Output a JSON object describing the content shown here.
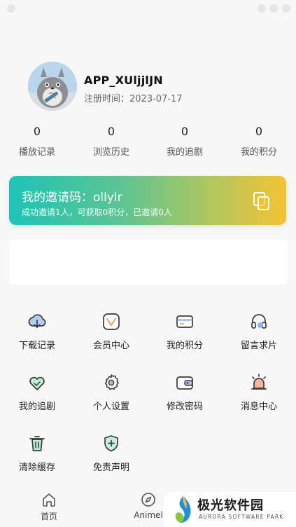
{
  "profile": {
    "username": "APP_XUljjlJN",
    "register_date": "注册时间：2023-07-17"
  },
  "stats": [
    {
      "value": "0",
      "label": "播放记录"
    },
    {
      "value": "0",
      "label": "浏览历史"
    },
    {
      "value": "0",
      "label": "我的追剧"
    },
    {
      "value": "0",
      "label": "我的积分"
    }
  ],
  "invite": {
    "code_text": "我的邀请码：ollylr",
    "desc": "成功邀请1人，可获取0积分，已邀请0人",
    "gradient_start": "#1ec3b6",
    "gradient_end": "#f5c233"
  },
  "menu": [
    {
      "label": "下载记录",
      "icon": "cloud-download-icon"
    },
    {
      "label": "会员中心",
      "icon": "vip-badge-icon"
    },
    {
      "label": "我的积分",
      "icon": "card-icon"
    },
    {
      "label": "留言求片",
      "icon": "headset-icon"
    },
    {
      "label": "我的追剧",
      "icon": "heart-icon"
    },
    {
      "label": "个人设置",
      "icon": "gear-icon"
    },
    {
      "label": "修改密码",
      "icon": "wallet-lock-icon"
    },
    {
      "label": "消息中心",
      "icon": "alarm-icon"
    },
    {
      "label": "清除缓存",
      "icon": "trash-icon"
    },
    {
      "label": "免责声明",
      "icon": "shield-plus-icon"
    }
  ],
  "tabs": [
    {
      "label": "首页",
      "icon": "home-icon"
    },
    {
      "label": "Animel",
      "icon": "compass-icon"
    }
  ],
  "watermark": {
    "cn": "极光软件园",
    "en": "AURORA SOFTWARE PARK"
  },
  "colors": {
    "icon_stroke": "#3a3a3a",
    "icon_accent": "#7fb0e8",
    "icon_warm": "#f3a37a",
    "icon_green": "#7cd3a8"
  }
}
